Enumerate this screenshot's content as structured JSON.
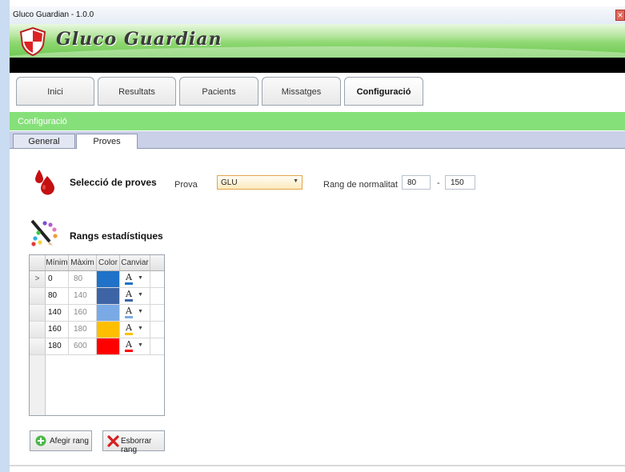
{
  "window": {
    "title": "Gluco Guardian - 1.0.0",
    "close_symbol": "✕"
  },
  "banner": {
    "brand": "Gluco Guardian"
  },
  "main_tabs": [
    {
      "label": "Inici"
    },
    {
      "label": "Resultats"
    },
    {
      "label": "Pacients"
    },
    {
      "label": "Missatges"
    },
    {
      "label": "Configuració",
      "active": true
    }
  ],
  "section": {
    "title": "Configuració"
  },
  "sub_tabs": [
    {
      "label": "General"
    },
    {
      "label": "Proves",
      "active": true
    }
  ],
  "proves": {
    "title": "Selecció de proves",
    "prova_label": "Prova",
    "prova_value": "GLU",
    "rang_label": "Rang de normalitat",
    "rang_min": "80",
    "rang_sep": "-",
    "rang_max": "150"
  },
  "rangs": {
    "title": "Rangs estadístiques",
    "columns": [
      "Mínim",
      "Màxim",
      "Color",
      "Canviar"
    ],
    "current_row_marker": ">",
    "font_glyph": "A",
    "rows": [
      {
        "min": "0",
        "max": "80",
        "color": "#1f72c8"
      },
      {
        "min": "80",
        "max": "140",
        "color": "#3d65a6"
      },
      {
        "min": "140",
        "max": "160",
        "color": "#7aaae6"
      },
      {
        "min": "160",
        "max": "180",
        "color": "#ffbf00"
      },
      {
        "min": "180",
        "max": "600",
        "color": "#ff0000"
      }
    ]
  },
  "buttons": {
    "add": "Afegir rang",
    "delete": "Esborrar rang"
  },
  "colors": {
    "accent_green": "#86e07a",
    "banner_green": "#6cc84f",
    "combo_border": "#e2a64a"
  }
}
